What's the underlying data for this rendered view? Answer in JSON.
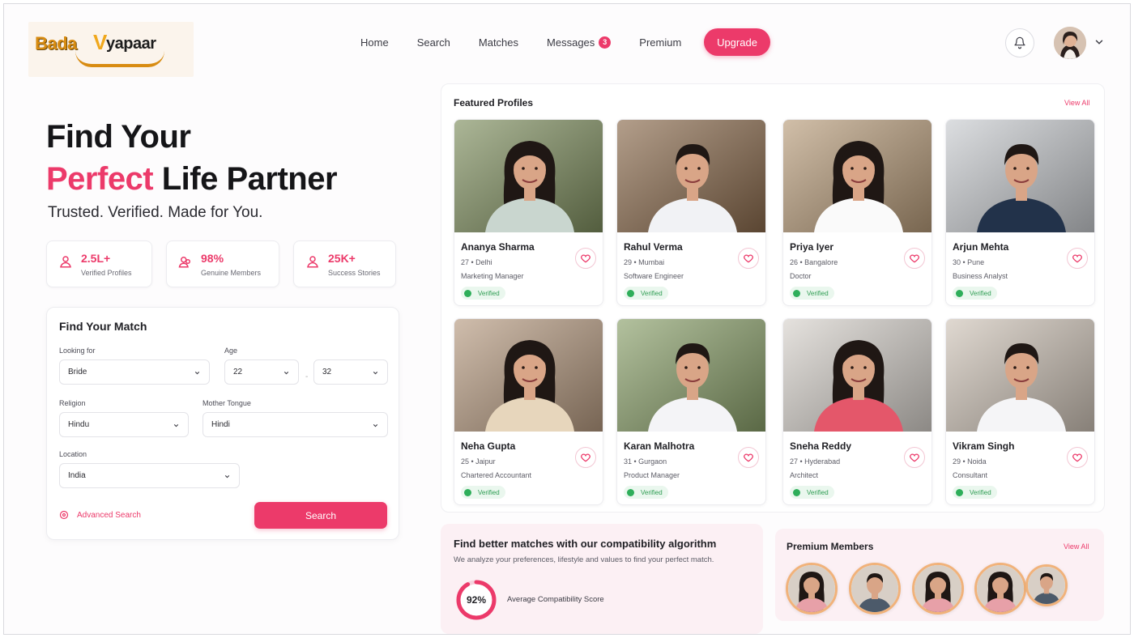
{
  "brand": {
    "logo_text": "BadaVyapaar",
    "logo_part1": "Bada",
    "logo_part2": "yapaar"
  },
  "nav": {
    "items": [
      {
        "label": "Home"
      },
      {
        "label": "Search"
      },
      {
        "label": "Matches"
      },
      {
        "label": "Messages",
        "badge": "3"
      },
      {
        "label": "Premium"
      }
    ],
    "upgrade_label": "Upgrade",
    "accent_color": "#ec3a6a"
  },
  "hero": {
    "title_line1": "Find Your",
    "title_highlight": "Perfect",
    "title_rest": "Life Partner",
    "subtitle": "Trusted. Verified. Made for You."
  },
  "stats": [
    {
      "value": "2.5L+",
      "label": "Verified Profiles",
      "icon": "user-icon"
    },
    {
      "value": "98%",
      "label": "Genuine Members",
      "icon": "members-icon"
    },
    {
      "value": "25K+",
      "label": "Success Stories",
      "icon": "user-icon"
    }
  ],
  "finder": {
    "title": "Find Your Match",
    "looking_for_label": "Looking for",
    "looking_for_value": "Bride",
    "age_label": "Age",
    "age_min": "22",
    "age_max": "32",
    "age_separator": "-",
    "religion_label": "Religion",
    "religion_value": "Hindu",
    "mother_tongue_label": "Mother Tongue",
    "mother_tongue_value": "Hindi",
    "location_label": "Location",
    "location_value": "India",
    "advanced_label": "Advanced Search",
    "search_label": "Search"
  },
  "featured": {
    "title": "Featured Profiles",
    "view_all": "View All",
    "profiles": [
      {
        "name": "Ananya Sharma",
        "meta": "27 • Delhi",
        "role": "Marketing Manager",
        "status": "Verified",
        "gender": "f"
      },
      {
        "name": "Rahul Verma",
        "meta": "29 • Mumbai",
        "role": "Software Engineer",
        "status": "Verified",
        "gender": "m"
      },
      {
        "name": "Priya Iyer",
        "meta": "26 • Bangalore",
        "role": "Doctor",
        "status": "Verified",
        "gender": "f"
      },
      {
        "name": "Arjun Mehta",
        "meta": "30 • Pune",
        "role": "Business Analyst",
        "status": "Verified",
        "gender": "m"
      },
      {
        "name": "Neha Gupta",
        "meta": "25 • Jaipur",
        "role": "Chartered Accountant",
        "status": "Verified",
        "gender": "f"
      },
      {
        "name": "Karan Malhotra",
        "meta": "31 • Gurgaon",
        "role": "Product Manager",
        "status": "Verified",
        "gender": "m"
      },
      {
        "name": "Sneha Reddy",
        "meta": "27 • Hyderabad",
        "role": "Architect",
        "status": "Verified",
        "gender": "f"
      },
      {
        "name": "Vikram Singh",
        "meta": "29 • Noida",
        "role": "Consultant",
        "status": "Verified",
        "gender": "m"
      }
    ]
  },
  "compatibility": {
    "title": "Find better matches with our compatibility algorithm",
    "subtitle": "We analyze your preferences, lifestyle and values to find your perfect match.",
    "score": "92%",
    "score_value": 0.92,
    "score_label": "Average Compatibility Score"
  },
  "premium": {
    "title": "Premium Members",
    "view_all": "View All",
    "members": [
      "f",
      "m",
      "f",
      "f",
      "m"
    ]
  }
}
